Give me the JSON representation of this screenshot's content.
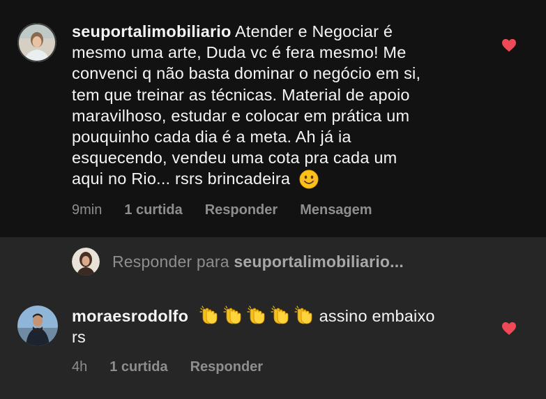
{
  "comment1": {
    "username": "seuportalimobiliario",
    "lines": [
      " Atender e Negociar é",
      "mesmo uma arte,  Duda vc é fera mesmo! Me",
      "convenci q não basta dominar o negócio em si,",
      "tem que treinar as técnicas. Material de apoio",
      "maravilhoso, estudar e colocar em prática um",
      "pouquinho cada dia é a meta. Ah já ia",
      "esquecendo, vendeu uma cota pra cada um",
      "aqui no Rio... rsrs brincadeira"
    ],
    "emoji": "smiling-face",
    "time": "9min",
    "likes": "1 curtida",
    "reply": "Responder",
    "message": "Mensagem",
    "liked": true
  },
  "reply_bar": {
    "prefix": "Responder para ",
    "target": "seuportalimobiliario..."
  },
  "comment2": {
    "username": "moraesrodolfo",
    "emoji": "clapping-hands",
    "emoji_count": 5,
    "text_after": " assino embaixo",
    "line2": "rs",
    "time": "4h",
    "likes": "1 curtida",
    "reply": "Responder",
    "liked": true
  },
  "colors": {
    "heart": "#ed4956",
    "comment_bg": "#121212",
    "page_bg": "#262626",
    "meta": "#8e8e8e"
  }
}
